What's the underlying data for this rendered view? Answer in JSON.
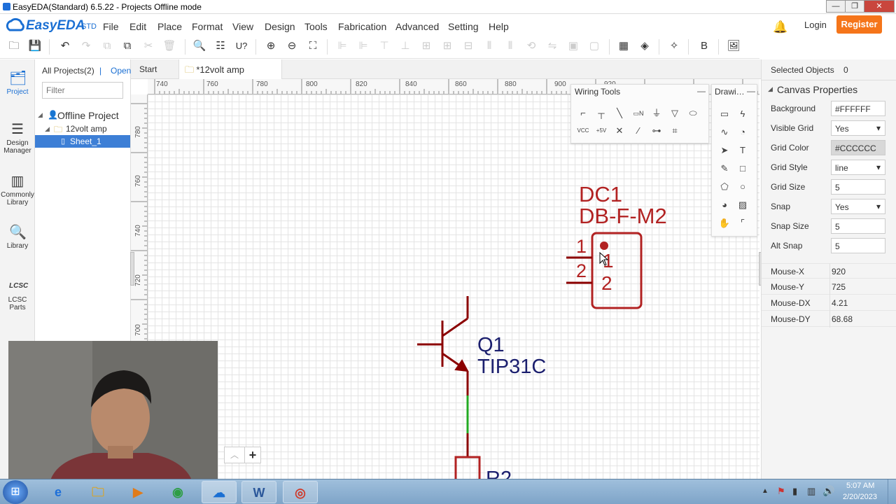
{
  "window": {
    "title": "EasyEDA(Standard) 6.5.22 - Projects Offline mode"
  },
  "app": {
    "brand": "EasyEDA",
    "brand_suffix": "STD",
    "login": "Login",
    "register": "Register",
    "accent": "#F5751A"
  },
  "menu": [
    "File",
    "Edit",
    "Place",
    "Format",
    "View",
    "Design",
    "Tools",
    "Fabrication",
    "Advanced",
    "Setting",
    "Help"
  ],
  "nav": [
    {
      "label": "Project",
      "icon": "folder-icon"
    },
    {
      "label": "Design Manager",
      "icon": "list-icon"
    },
    {
      "label": "Commonly Library",
      "icon": "chip-icon"
    },
    {
      "label": "Library",
      "icon": "search-library-icon"
    },
    {
      "label": "LCSC Parts",
      "icon": "lcsc-icon"
    }
  ],
  "project_panel": {
    "all_projects": "All Projects(2)",
    "divider": "|",
    "open": "Open",
    "filter_placeholder": "Filter",
    "tree": {
      "root": "Offline Project",
      "project": "12volt amp",
      "sheet": "Sheet_1"
    }
  },
  "tabs": [
    {
      "label": "Start"
    },
    {
      "label": "*12volt amp"
    }
  ],
  "ruler": {
    "top": [
      "740",
      "760",
      "780",
      "800",
      "820",
      "840",
      "860",
      "880",
      "900",
      "920"
    ],
    "left": [
      "780",
      "760",
      "740",
      "720",
      "700"
    ]
  },
  "wiring_tools": {
    "title": "Wiring Tools",
    "collapse": "—"
  },
  "drawing_tools": {
    "title": "Drawi…",
    "collapse": "—"
  },
  "schematic": {
    "dc1_ref": "DC1",
    "dc1_part": "DB-F-M2",
    "pin1": "1",
    "pin2": "2",
    "pin1_inner": "1",
    "pin2_inner": "2",
    "q1_ref": "Q1",
    "q1_part": "TIP31C",
    "r_ref": "R2",
    "wire_color": "#8B0000",
    "net_color": "#22AA22",
    "designator_color": "#B22222",
    "part_color": "#1B1F6E"
  },
  "right_panel": {
    "selected_label": "Selected Objects",
    "selected_count": "0",
    "section": "Canvas Properties",
    "props": [
      {
        "label": "Background",
        "value": "#FFFFFF"
      },
      {
        "label": "Visible Grid",
        "value": "Yes"
      },
      {
        "label": "Grid Color",
        "value": "#CCCCCC"
      },
      {
        "label": "Grid Style",
        "value": "line"
      },
      {
        "label": "Grid Size",
        "value": "5"
      },
      {
        "label": "Snap",
        "value": "Yes"
      },
      {
        "label": "Snap Size",
        "value": "5"
      },
      {
        "label": "Alt Snap",
        "value": "5"
      }
    ],
    "mouse": [
      {
        "label": "Mouse-X",
        "value": "920"
      },
      {
        "label": "Mouse-Y",
        "value": "725"
      },
      {
        "label": "Mouse-DX",
        "value": "4.21"
      },
      {
        "label": "Mouse-DY",
        "value": "68.68"
      }
    ]
  },
  "zoom": {
    "plus": "+"
  },
  "taskbar": {
    "time": "5:07 AM",
    "date": "2/20/2023"
  }
}
